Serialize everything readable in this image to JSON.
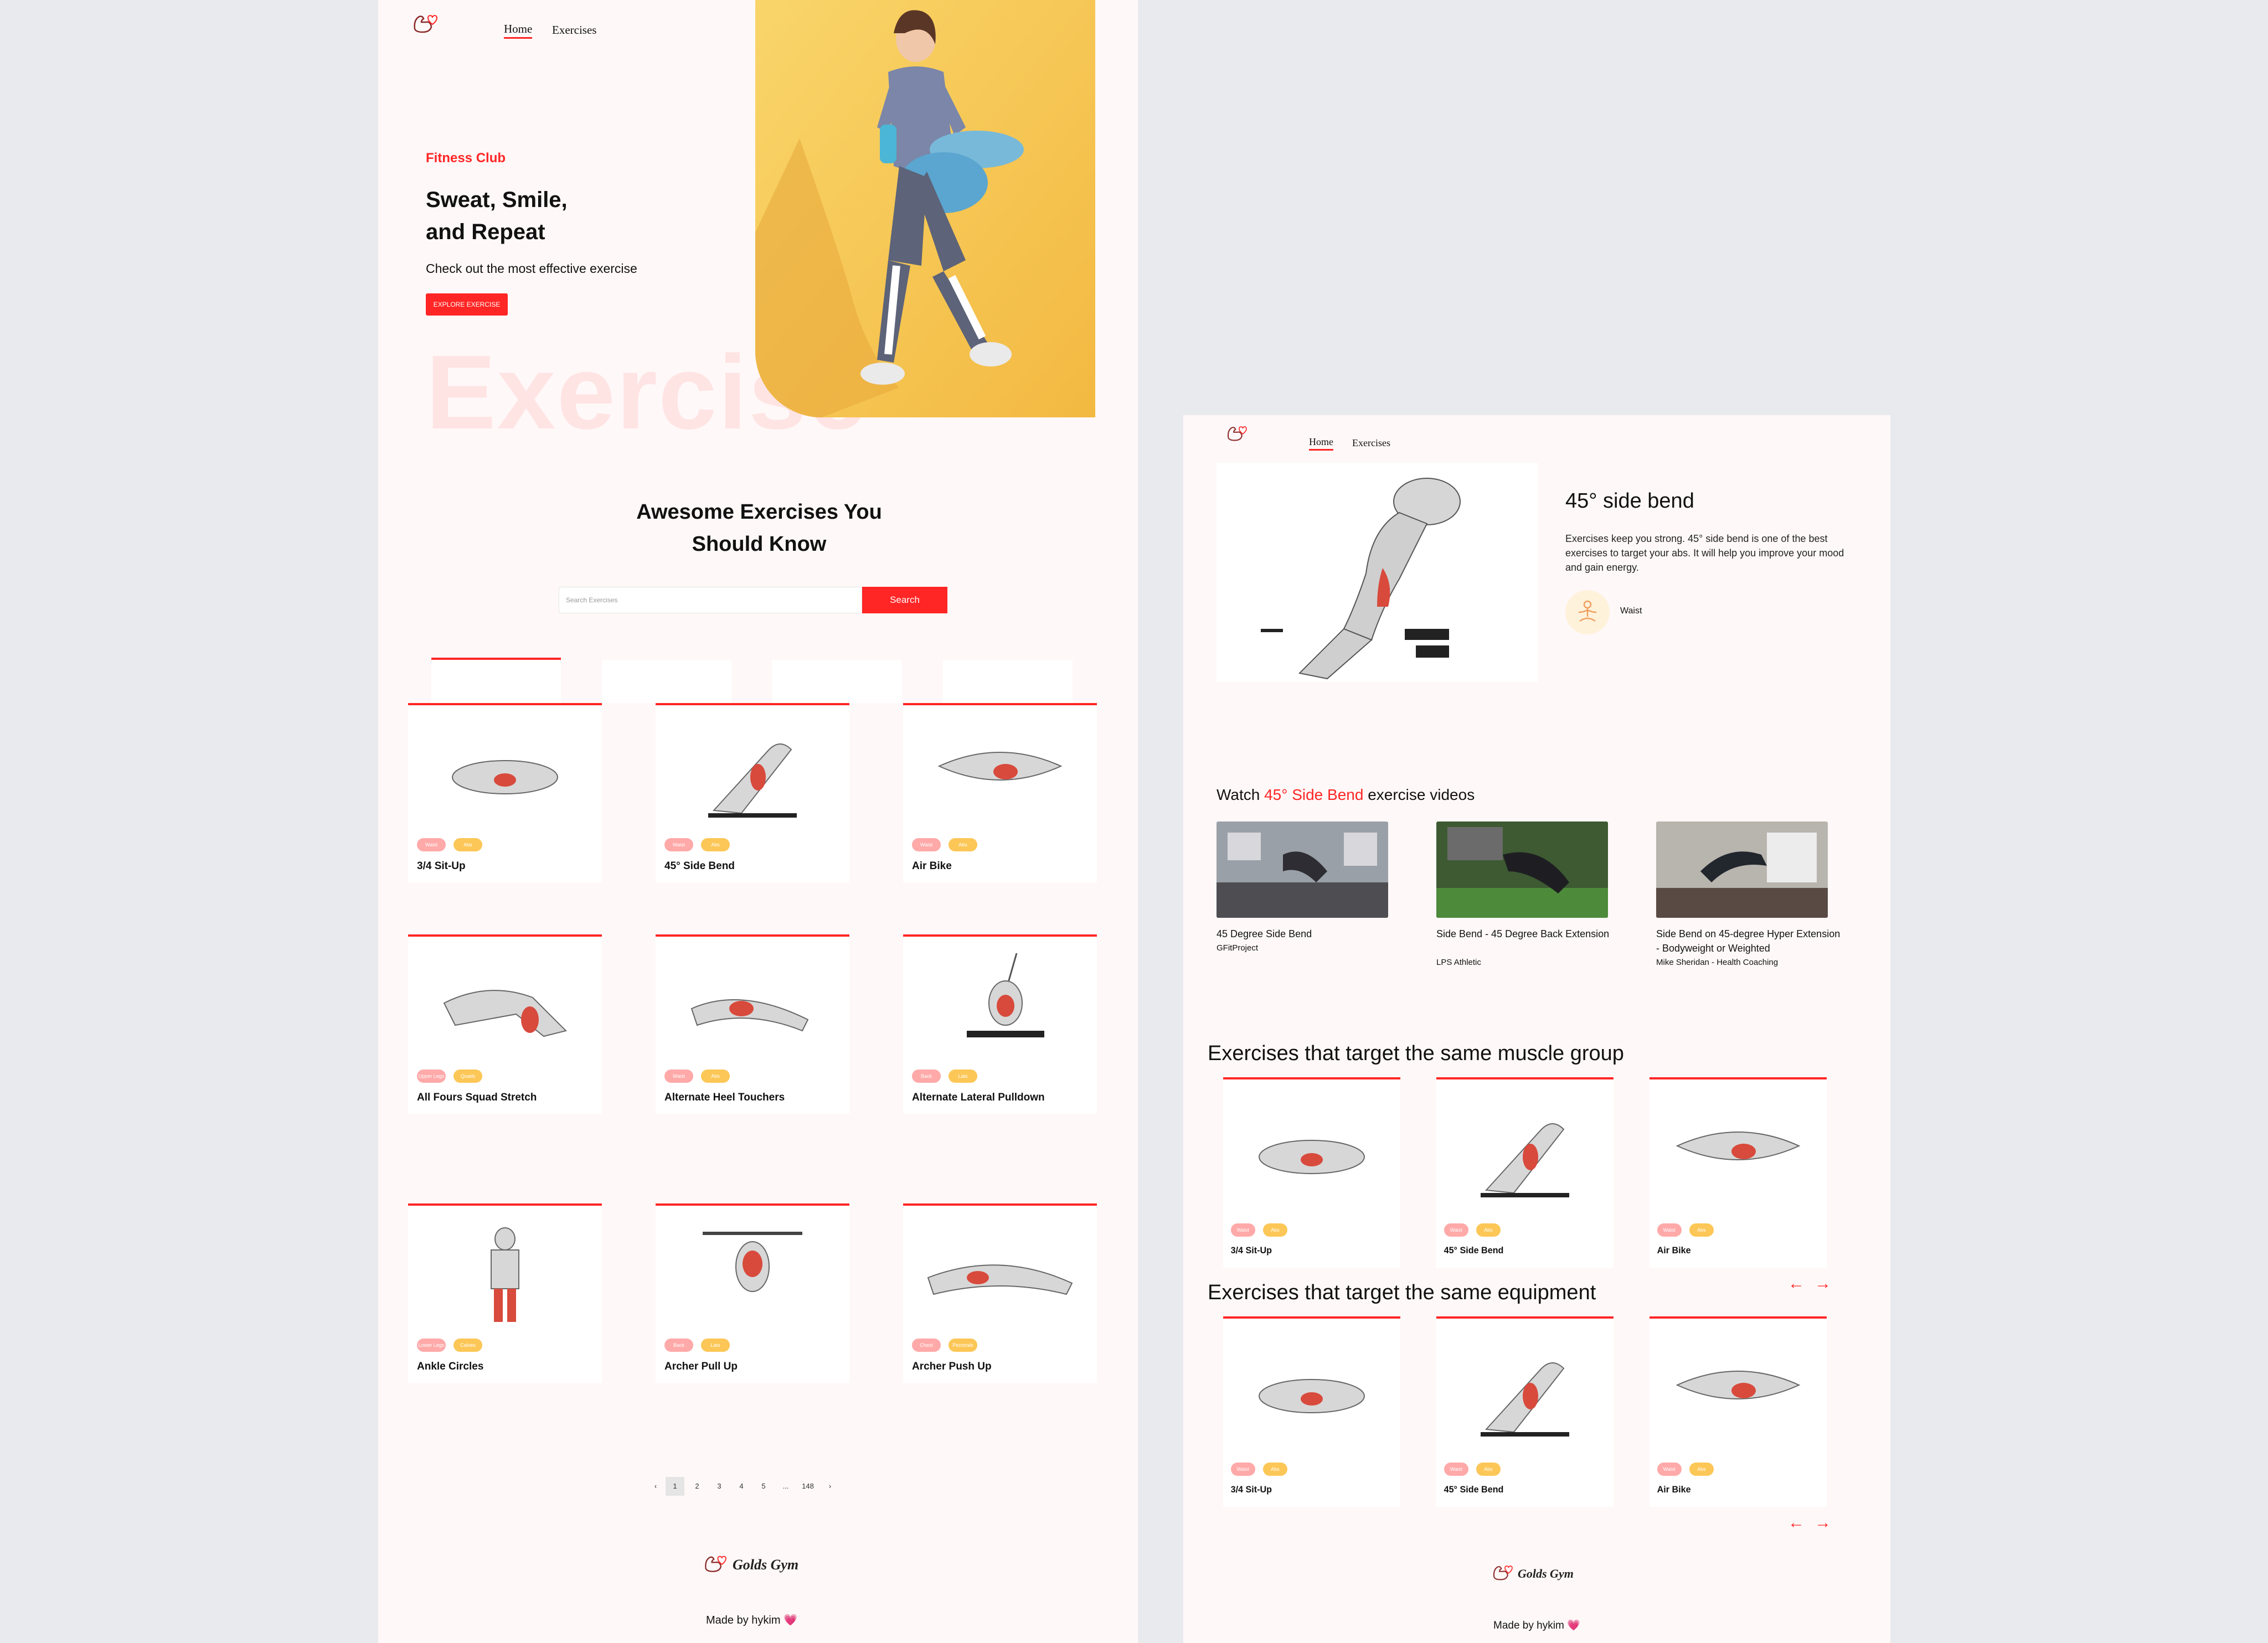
{
  "nav": {
    "home": "Home",
    "exercises": "Exercises"
  },
  "hero": {
    "kicker": "Fitness Club",
    "title_line1": "Sweat, Smile,",
    "title_line2": "and Repeat",
    "subtitle": "Check out the most effective exercise",
    "cta": "EXPLORE EXERCISE",
    "watermark": "Exercise"
  },
  "search": {
    "heading_line1": "Awesome Exercises You",
    "heading_line2": "Should Know",
    "placeholder": "Search Exercises",
    "button": "Search"
  },
  "exercises": [
    {
      "name": "3/4 Sit-Up",
      "tags": [
        "Waist",
        "Abs"
      ]
    },
    {
      "name": "45° Side Bend",
      "tags": [
        "Waist",
        "Abs"
      ]
    },
    {
      "name": "Air Bike",
      "tags": [
        "Waist",
        "Abs"
      ]
    },
    {
      "name": "All Fours Squad Stretch",
      "tags": [
        "Upper Legs",
        "Quads"
      ]
    },
    {
      "name": "Alternate Heel Touchers",
      "tags": [
        "Waist",
        "Abs"
      ]
    },
    {
      "name": "Alternate Lateral Pulldown",
      "tags": [
        "Back",
        "Lats"
      ]
    },
    {
      "name": "Ankle Circles",
      "tags": [
        "Lower Legs",
        "Calves"
      ]
    },
    {
      "name": "Archer Pull Up",
      "tags": [
        "Back",
        "Lats"
      ]
    },
    {
      "name": "Archer Push Up",
      "tags": [
        "Chest",
        "Pectorals"
      ]
    }
  ],
  "pagination": {
    "prev": "‹",
    "pages": [
      "1",
      "2",
      "3",
      "4",
      "5"
    ],
    "ellipsis": "...",
    "last": "148",
    "next": "›",
    "current": "1"
  },
  "footer": {
    "brand": "Golds Gym",
    "made_by": "Made by hykim 💗"
  },
  "detail": {
    "title": "45° side bend",
    "description": "Exercises keep you strong. 45° side bend is one of the best exercises to target your abs. It will help you improve your mood and gain energy.",
    "target_label": "Waist",
    "videos_heading_pre": "Watch ",
    "videos_heading_name": "45° Side Bend",
    "videos_heading_post": " exercise videos",
    "videos": [
      {
        "title": "45 Degree Side Bend",
        "channel": "GFitProject"
      },
      {
        "title": "Side Bend - 45 Degree Back Extension",
        "channel": "LPS Athletic"
      },
      {
        "title": "Side Bend on 45-degree Hyper Extension - Bodyweight or Weighted",
        "channel": "Mike Sheridan - Health Coaching"
      }
    ],
    "similar_muscle_heading": "Exercises that target the same muscle group",
    "similar_equipment_heading": "Exercises that target the same equipment",
    "similar_cards": [
      {
        "name": "3/4 Sit-Up",
        "tags": [
          "Waist",
          "Abs"
        ]
      },
      {
        "name": "45° Side Bend",
        "tags": [
          "Waist",
          "Abs"
        ]
      },
      {
        "name": "Air Bike",
        "tags": [
          "Waist",
          "Abs"
        ]
      }
    ],
    "arrow_left": "←",
    "arrow_right": "→"
  },
  "colors": {
    "accent": "#ff2625",
    "pill_pink": "#ffa9a9",
    "pill_yellow": "#fcc757",
    "panel_bg": "#fff8f8",
    "page_bg": "#e9eaee"
  }
}
